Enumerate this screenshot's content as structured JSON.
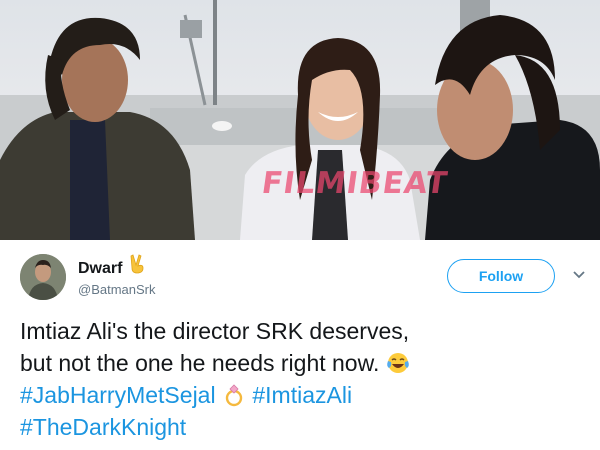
{
  "photo": {
    "alt": "",
    "watermark": "FILMIBEAT"
  },
  "tweet": {
    "author": {
      "name": "Dwarf",
      "handle": "@BatmanSrk",
      "name_emoji": "victory-hand-icon"
    },
    "follow_label": "Follow",
    "menu_icon": "chevron-down-icon",
    "text": {
      "line1": "Imtiaz Ali's the director SRK deserves,",
      "line2": "but not the one he needs right now.",
      "line2_emoji": "face-with-tears-of-joy-icon",
      "hashtag1": "#JabHarryMetSejal",
      "ring_emoji": "ring-icon",
      "hashtag2": "#ImtiazAli",
      "hashtag3": "#TheDarkKnight"
    },
    "colors": {
      "accent": "#1da1f2",
      "hashtag": "#1b95e0",
      "handle": "#657786",
      "text": "#14171a"
    }
  }
}
